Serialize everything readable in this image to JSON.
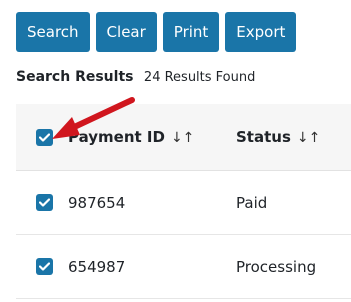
{
  "toolbar": {
    "buttons": [
      {
        "label": "Search"
      },
      {
        "label": "Clear"
      },
      {
        "label": "Print"
      },
      {
        "label": "Export"
      }
    ]
  },
  "results": {
    "title": "Search Results",
    "count_text": "24 Results Found"
  },
  "table": {
    "columns": [
      {
        "label": "Payment ID",
        "sort_icon": "sort-arrows-icon"
      },
      {
        "label": "Status",
        "sort_icon": "sort-arrows-icon"
      }
    ],
    "select_all_checked": true,
    "rows": [
      {
        "payment_id": "987654",
        "status": "Paid",
        "checked": true
      },
      {
        "payment_id": "654987",
        "status": "Processing",
        "checked": true
      }
    ]
  },
  "colors": {
    "accent": "#1a75a8",
    "annotation_arrow": "#d0161e"
  }
}
